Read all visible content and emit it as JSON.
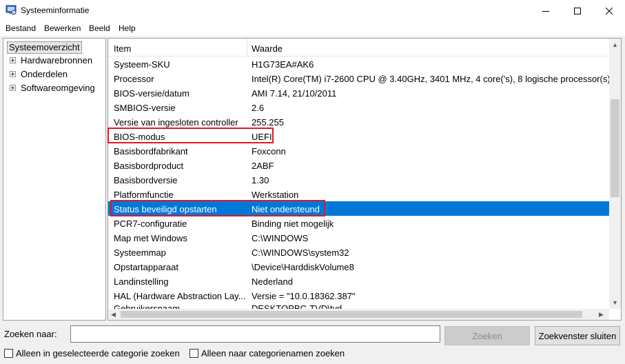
{
  "window": {
    "title": "Systeeminformatie",
    "icon": "system-information-icon"
  },
  "menu": [
    "Bestand",
    "Bewerken",
    "Beeld",
    "Help"
  ],
  "tree": {
    "root": "Systeemoverzicht",
    "children": [
      "Hardwarebronnen",
      "Onderdelen",
      "Softwareomgeving"
    ]
  },
  "list": {
    "headers": {
      "item": "Item",
      "value": "Waarde"
    },
    "rows": [
      {
        "item": "Systeem-SKU",
        "value": "H1G73EA#AK6"
      },
      {
        "item": "Processor",
        "value": "Intel(R) Core(TM) i7-2600 CPU @ 3.40GHz, 3401 MHz, 4 core('s), 8 logische processor(s)"
      },
      {
        "item": "BIOS-versie/datum",
        "value": "AMI 7.14, 21/10/2011"
      },
      {
        "item": "SMBIOS-versie",
        "value": "2.6"
      },
      {
        "item": "Versie van ingesloten controller",
        "value": "255.255"
      },
      {
        "item": "BIOS-modus",
        "value": "UEFI"
      },
      {
        "item": "Basisbordfabrikant",
        "value": "Foxconn"
      },
      {
        "item": "Basisbordproduct",
        "value": "2ABF"
      },
      {
        "item": "Basisbordversie",
        "value": "1.30"
      },
      {
        "item": "Platformfunctie",
        "value": "Werkstation"
      },
      {
        "item": "Status beveiligd opstarten",
        "value": "Niet ondersteund"
      },
      {
        "item": "PCR7-configuratie",
        "value": "Binding niet mogelijk"
      },
      {
        "item": "Map met Windows",
        "value": "C:\\WINDOWS"
      },
      {
        "item": "Systeemmap",
        "value": "C:\\WINDOWS\\system32"
      },
      {
        "item": "Opstartapparaat",
        "value": "\\Device\\HarddiskVolume8"
      },
      {
        "item": "Landinstelling",
        "value": "Nederland"
      },
      {
        "item": "HAL (Hardware Abstraction Lay...",
        "value": "Versie = \"10.0.18362.387\""
      },
      {
        "item": "Gebruikersnaam",
        "value": "DESKTOPBC-TVD\\tvd"
      }
    ],
    "selected_item": "Status beveiligd opstarten",
    "highlighted_items": [
      "BIOS-modus",
      "Status beveiligd opstarten"
    ]
  },
  "search": {
    "label": "Zoeken naar:",
    "value": "",
    "find_button": "Zoeken",
    "close_button": "Zoekvenster sluiten",
    "option_selected_category": "Alleen in geselecteerde categorie zoeken",
    "option_category_names": "Alleen naar categorienamen zoeken"
  },
  "colors": {
    "selection": "#0078d7",
    "highlight_box": "#e11922"
  }
}
